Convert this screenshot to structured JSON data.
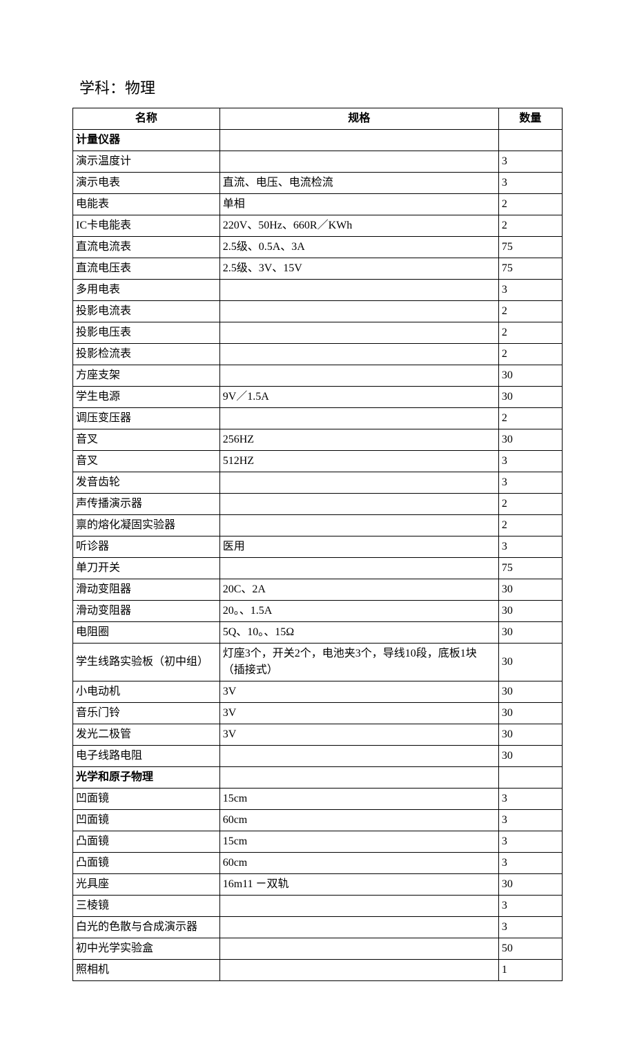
{
  "title": "学科：物理",
  "headers": {
    "name": "名称",
    "spec": "规格",
    "qty": "数量"
  },
  "rows": [
    {
      "name": "计量仪器",
      "spec": "",
      "qty": "",
      "section": true
    },
    {
      "name": "演示温度计",
      "spec": "",
      "qty": "3"
    },
    {
      "name": "演示电表",
      "spec": "直流、电压、电流检流",
      "qty": "3"
    },
    {
      "name": "电能表",
      "spec": "单相",
      "qty": "2"
    },
    {
      "name": "IC卡电能表",
      "spec": "220V、50Hz、660R／KWh",
      "qty": "2"
    },
    {
      "name": "直流电流表",
      "spec": "2.5级、0.5A、3A",
      "qty": "75"
    },
    {
      "name": "直流电压表",
      "spec": "2.5级、3V、15V",
      "qty": "75"
    },
    {
      "name": "多用电表",
      "spec": "",
      "qty": "3"
    },
    {
      "name": "投影电流表",
      "spec": "",
      "qty": "2"
    },
    {
      "name": "投影电压表",
      "spec": "",
      "qty": "2"
    },
    {
      "name": "投影检流表",
      "spec": "",
      "qty": "2"
    },
    {
      "name": "方座支架",
      "spec": "",
      "qty": "30"
    },
    {
      "name": "学生电源",
      "spec": "9V／1.5A",
      "qty": "30"
    },
    {
      "name": "调压变压器",
      "spec": "",
      "qty": "2"
    },
    {
      "name": "音叉",
      "spec": "256HZ",
      "qty": "30"
    },
    {
      "name": "音叉",
      "spec": "512HZ",
      "qty": "3"
    },
    {
      "name": "发音齿轮",
      "spec": "",
      "qty": "3"
    },
    {
      "name": "声传播演示器",
      "spec": "",
      "qty": "2"
    },
    {
      "name": "禀的熔化凝固实验器",
      "spec": "",
      "qty": "2"
    },
    {
      "name": "听诊器",
      "spec": "医用",
      "qty": "3"
    },
    {
      "name": "单刀开关",
      "spec": "",
      "qty": "75"
    },
    {
      "name": "滑动变阻器",
      "spec": "20C、2A",
      "qty": "30"
    },
    {
      "name": "滑动变阻器",
      "spec": "20。、1.5A",
      "qty": "30"
    },
    {
      "name": "电阻圈",
      "spec": "5Q、10。、15Ω",
      "qty": "30"
    },
    {
      "name": "学生线路实验板（初中组）",
      "spec": "灯座3个，开关2个，电池夹3个，导线10段，底板1块（插接式）",
      "qty": "30"
    },
    {
      "name": "小电动机",
      "spec": "3V",
      "qty": "30"
    },
    {
      "name": "音乐门铃",
      "spec": "3V",
      "qty": "30"
    },
    {
      "name": "发光二极管",
      "spec": "3V",
      "qty": "30"
    },
    {
      "name": "电子线路电阻",
      "spec": "",
      "qty": "30"
    },
    {
      "name": "光学和原子物理",
      "spec": "",
      "qty": "",
      "section": true
    },
    {
      "name": "凹面镜",
      "spec": "15cm",
      "qty": "3"
    },
    {
      "name": "凹面镜",
      "spec": "60cm",
      "qty": "3"
    },
    {
      "name": "凸面镜",
      "spec": "15cm",
      "qty": "3"
    },
    {
      "name": "凸面镜",
      "spec": "60cm",
      "qty": "3"
    },
    {
      "name": "光具座",
      "spec": "16m11 ㄧ双轨",
      "qty": "30"
    },
    {
      "name": "三棱镜",
      "spec": "",
      "qty": "3"
    },
    {
      "name": "白光的色散与合成演示器",
      "spec": "",
      "qty": "3"
    },
    {
      "name": "初中光学实验盒",
      "spec": "",
      "qty": "50"
    },
    {
      "name": "照相机",
      "spec": "",
      "qty": "1"
    }
  ]
}
